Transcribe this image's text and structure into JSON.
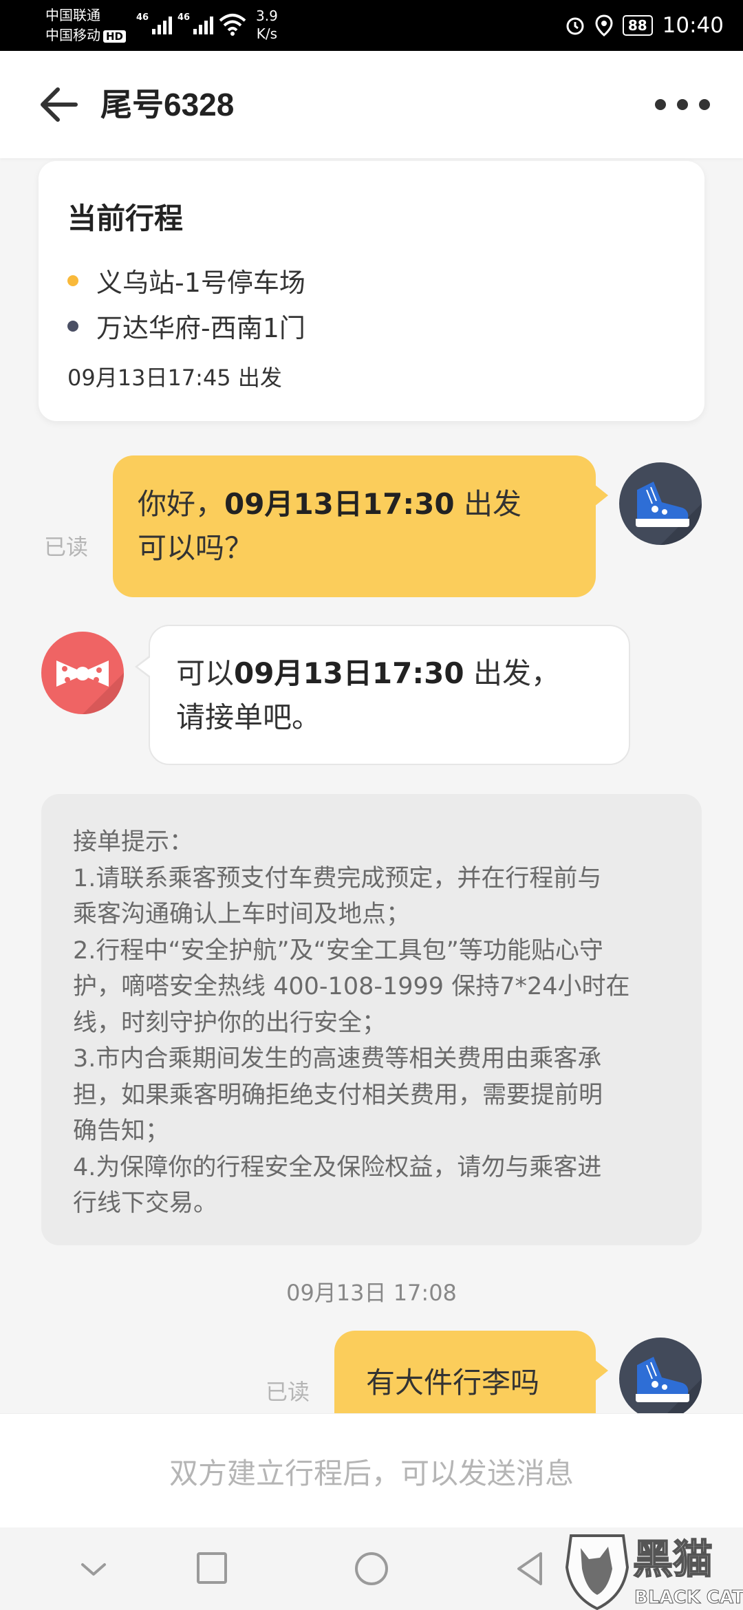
{
  "status_bar": {
    "carrier1": "中国联通",
    "carrier2": "中国移动",
    "hd": "HD",
    "signal_label": "46",
    "speed_value": "3.9",
    "speed_unit": "K/s",
    "battery": "88",
    "time": "10:40"
  },
  "header": {
    "title": "尾号6328"
  },
  "trip": {
    "title": "当前行程",
    "start": "义乌站-1号停车场",
    "end": "万达华府-西南1门",
    "depart_time": "09月13日17:45 出发",
    "start_dot_color": "#f9b93a",
    "end_dot_color": "#4a4f64"
  },
  "messages": {
    "msg1": {
      "read": "已读",
      "prefix": "你好，",
      "time": "09月13日17:30",
      "suffix": " 出发",
      "line2": "可以吗？"
    },
    "msg2": {
      "prefix": "可以",
      "time": "09月13日17:30",
      "suffix": " 出发，",
      "line2": "请接单吧。"
    },
    "msg3": {
      "read": "已读",
      "text": "有大件行李吗"
    }
  },
  "tips": {
    "heading": "接单提示：",
    "lines": [
      "1.请联系乘客预支付车费完成预定，并在行程前与",
      "乘客沟通确认上车时间及地点；",
      "2.行程中“安全护航”及“安全工具包”等功能贴心守",
      "护，嘀嗒安全热线  400-108-1999 保持7*24小时在",
      "线，时刻守护你的出行安全；",
      "3.市内合乘期间发生的高速费等相关费用由乘客承",
      "担，如果乘客明确拒绝支付相关费用，需要提前明",
      "确告知；",
      "4.为保障你的行程安全及保险权益，请勿与乘客进",
      "行线下交易。"
    ]
  },
  "timestamp": "09月13日 17:08",
  "input_hint": "双方建立行程后，可以发送消息",
  "watermark": {
    "cn": "黑猫",
    "en": "BLACK CAT"
  },
  "colors": {
    "accent_yellow": "#fbcd5b",
    "driver_avatar_bg": "#424a5a",
    "passenger_avatar_bg": "#ef6464"
  }
}
